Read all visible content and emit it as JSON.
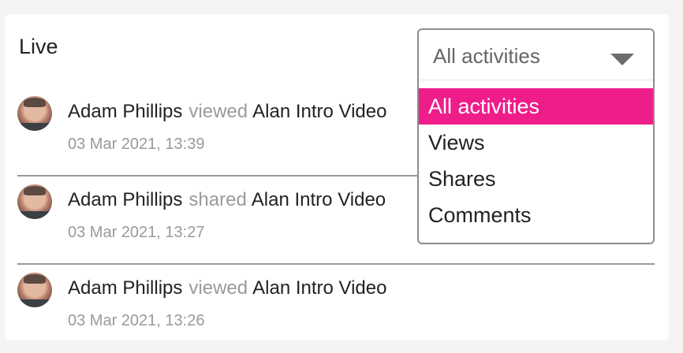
{
  "header": {
    "title": "Live"
  },
  "filter": {
    "selected": "All activities",
    "options": [
      "All activities",
      "Views",
      "Shares",
      "Comments"
    ]
  },
  "activities": [
    {
      "user": "Adam Phillips",
      "action": "viewed",
      "item": "Alan Intro Video",
      "timestamp": "03 Mar 2021, 13:39"
    },
    {
      "user": "Adam Phillips",
      "action": "shared",
      "item": "Alan Intro Video",
      "timestamp": "03 Mar 2021, 13:27"
    },
    {
      "user": "Adam Phillips",
      "action": "viewed",
      "item": "Alan Intro Video",
      "timestamp": "03 Mar 2021, 13:26"
    }
  ],
  "colors": {
    "accent": "#ef1d8a",
    "muted": "#9a9a9a",
    "text": "#222222"
  }
}
